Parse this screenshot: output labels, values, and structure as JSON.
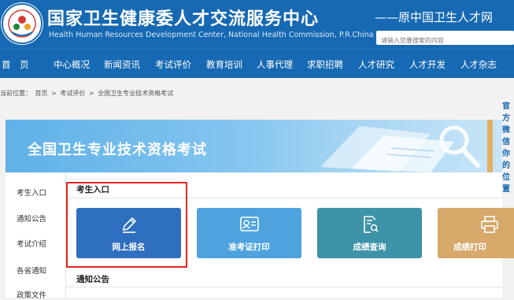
{
  "header": {
    "title_cn": "国家卫生健康委人才交流服务中心",
    "title_en": "Health Human Resources Development Center, National Health Commission, P.R.China",
    "subtitle": "——原中国卫生人才网",
    "search_placeholder": "请输入您要搜索的内容"
  },
  "nav": {
    "items": [
      "首　页",
      "中心概况",
      "新闻资讯",
      "考试评价",
      "教育培训",
      "人事代理",
      "求职招聘",
      "人才研究",
      "人才开发",
      "人才杂志"
    ]
  },
  "breadcrumb": {
    "prefix": "当前位置：",
    "items": [
      "首页",
      "考试评价",
      "全国卫生专业技术资格考试"
    ],
    "separator": ">"
  },
  "side_text": "官方微信 你的位置",
  "banner": {
    "title": "全国卫生专业技术资格考试"
  },
  "sidebar": {
    "items": [
      "考生入口",
      "通知公告",
      "考试介绍",
      "各省通知",
      "政策文件"
    ]
  },
  "section": {
    "entry_title": "考生入口",
    "notice_title": "通知公告"
  },
  "tiles": [
    {
      "label": "网上报名",
      "color": "#2f6fc0",
      "icon": "pencil-icon"
    },
    {
      "label": "准考证打印",
      "color": "#4ea3df",
      "icon": "id-card-icon"
    },
    {
      "label": "成绩查询",
      "color": "#3d93a8",
      "icon": "search-doc-icon"
    },
    {
      "label": "成绩打印",
      "color": "#d6a86a",
      "icon": "printer-icon"
    }
  ],
  "colors": {
    "header_bg": "#1669b2",
    "highlight": "#e0251b"
  }
}
